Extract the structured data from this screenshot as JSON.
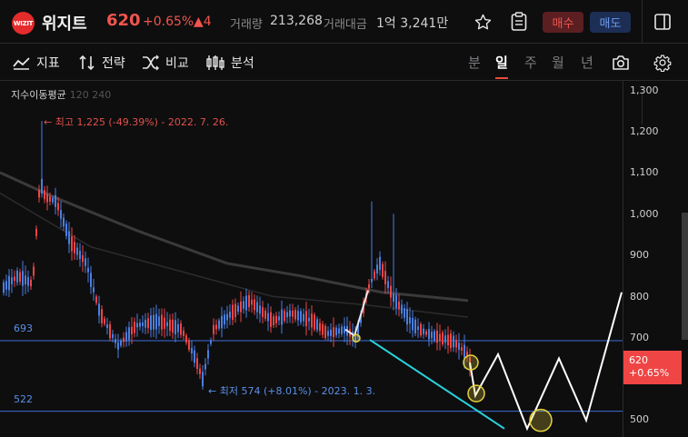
{
  "header": {
    "logo_text": "WIZIT",
    "stock_name": "위지트",
    "price": "620",
    "change_pct": "+0.65%",
    "change_abs": "▲4",
    "volume_label": "거래량",
    "volume_value": "213,268",
    "amount_label": "거래대금",
    "amount_value": "1억 3,241만",
    "buy_label": "매수",
    "sell_label": "매도",
    "icons": [
      "star-icon",
      "memo-icon",
      "panel-icon"
    ]
  },
  "toolbar": {
    "indicator_label": "지표",
    "strategy_label": "전략",
    "compare_label": "비교",
    "analysis_label": "분석",
    "periods": [
      "분",
      "일",
      "주",
      "월",
      "년"
    ],
    "active_period": "일"
  },
  "chart": {
    "legend_title": "지수이동평균",
    "legend_ma": "120 240",
    "high_annotation": "← 최고 1,225 (-49.39%) - 2022. 7. 26.",
    "low_annotation": "← 최저 574 (+8.01%) - 2023. 1. 3.",
    "line_693_label": "693",
    "line_522_label": "522",
    "price_tag_value": "620",
    "price_tag_change": "+0.65%",
    "colors": {
      "up": "#ef4545",
      "down": "#4a7fe0",
      "hline": "#3f6fd8",
      "trend": "#29d3dc",
      "marker": "#e6d23a"
    }
  },
  "chart_data": {
    "type": "candlestick",
    "ylim": [
      480,
      1310
    ],
    "yticks": [
      "1,300",
      "1,200",
      "1,100",
      "1,000",
      "900",
      "800",
      "700",
      "600",
      "500"
    ],
    "horizontal_lines": [
      693,
      522
    ],
    "high": {
      "value": 1225,
      "pct": "-49.39%",
      "date": "2022. 7. 26."
    },
    "low": {
      "value": 574,
      "pct": "+8.01%",
      "date": "2023. 1. 3."
    },
    "moving_averages": [
      "120",
      "240"
    ],
    "last_price": 620
  }
}
